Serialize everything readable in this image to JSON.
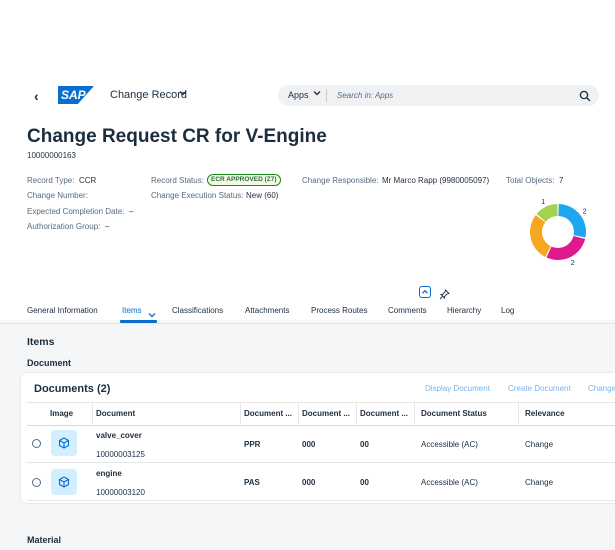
{
  "shell": {
    "back_glyph": "‹",
    "logo_text": "SAP",
    "app_title": "Change Record",
    "search": {
      "scope": "Apps",
      "placeholder": "Search in: Apps"
    }
  },
  "object": {
    "title": "Change Request CR for V-Engine",
    "number": "10000000163",
    "fields": {
      "record_type_label": "Record Type:",
      "record_type_value": "CCR",
      "change_number_label": "Change Number:",
      "expected_completion_label": "Expected Completion Date:",
      "expected_completion_value": "–",
      "authorization_group_label": "Authorization Group:",
      "authorization_group_value": "–",
      "record_status_label": "Record Status:",
      "record_status_value": "ECR APPROVED (Z7)",
      "execution_status_label": "Change Execution Status:",
      "execution_status_value": "New (60)",
      "responsible_label": "Change Responsible:",
      "responsible_value": "Mr Marco Rapp (9980005097)",
      "total_objects_label": "Total Objects:",
      "total_objects_value": "7"
    },
    "chart_data": {
      "type": "pie",
      "values": [
        1,
        2,
        2,
        2
      ],
      "colors": [
        "#a3d34e",
        "#1ea7f0",
        "#e0198f",
        "#f6a621"
      ],
      "labels": [
        "1",
        "2",
        "2",
        "2"
      ]
    }
  },
  "tabs": [
    "General Information",
    "Items",
    "Classifications",
    "Attachments",
    "Process Routes",
    "Comments",
    "Hierarchy",
    "Log"
  ],
  "active_tab": "Items",
  "items": {
    "section_title": "Items",
    "subsection_title": "Document",
    "documents": {
      "title": "Documents (2)",
      "actions": [
        "Display Document",
        "Create Document",
        "Change"
      ],
      "columns": [
        "Image",
        "Document",
        "Document ...",
        "Document ...",
        "Document ...",
        "Document Status",
        "Relevance"
      ],
      "rows": [
        {
          "name": "valve_cover",
          "number": "10000003125",
          "c1": "PPR",
          "c2": "000",
          "c3": "00",
          "status": "Accessible (AC)",
          "relevance": "Change"
        },
        {
          "name": "engine",
          "number": "10000003120",
          "c1": "PAS",
          "c2": "000",
          "c3": "00",
          "status": "Accessible (AC)",
          "relevance": "Change"
        }
      ]
    },
    "next_section": "Material"
  },
  "colors": {
    "accent": "#0a6ed1",
    "status_positive": "#188918"
  }
}
